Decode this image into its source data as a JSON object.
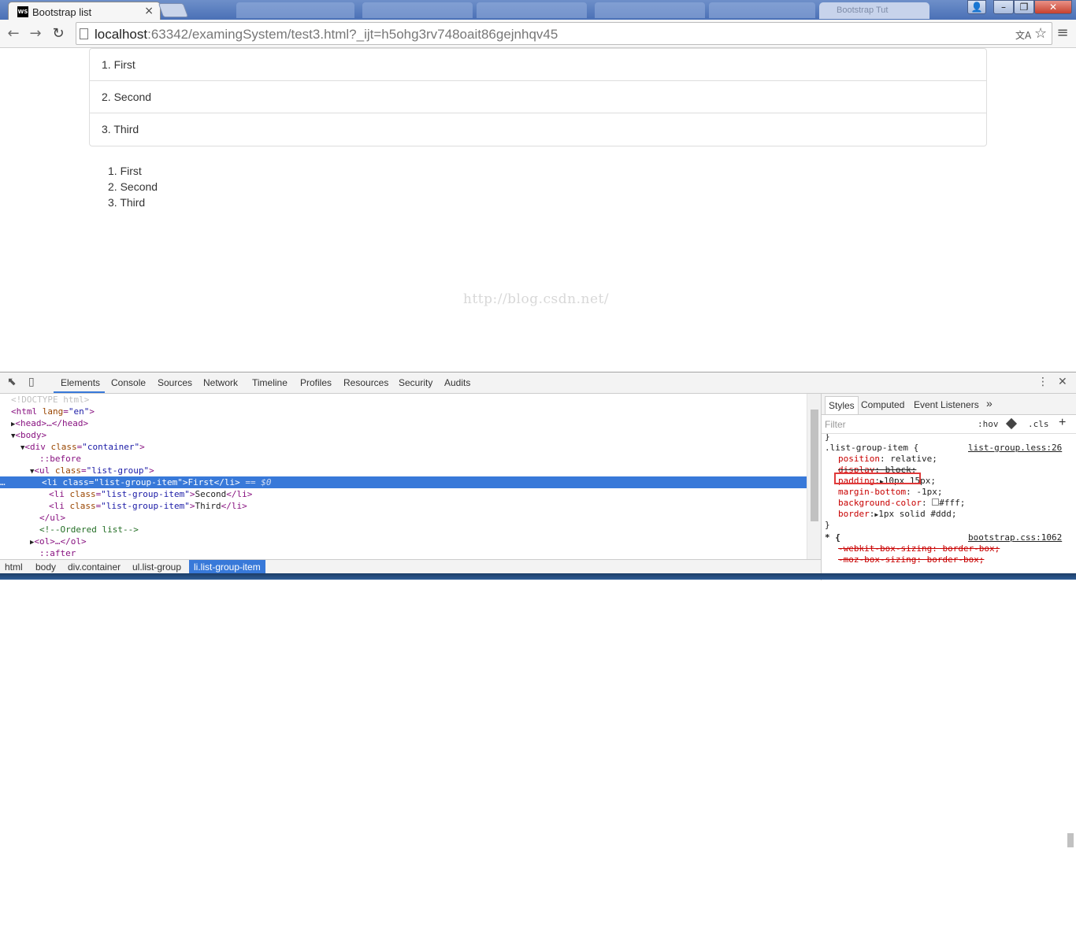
{
  "browser": {
    "tab": {
      "title": "Bootstrap list",
      "favicon": "WS",
      "close": "×"
    },
    "inactive_tab": {
      "title": "Bootstrap Tut"
    },
    "window_controls": {
      "user": "👤",
      "minimize": "–",
      "maximize": "❐",
      "close": "✕"
    },
    "toolbar": {
      "back": "←",
      "forward": "→",
      "reload": "↻",
      "url_host": "localhost",
      "url_rest": ":63342/examingSystem/test3.html?_ijt=h5ohg3rv748oait86gejnhqv45",
      "translate_icon": "文A",
      "star": "☆",
      "menu": "≡"
    }
  },
  "page": {
    "list_group": [
      "1. First",
      "2. Second",
      "3. Third"
    ],
    "ordered_list": [
      "1. First",
      "2. Second",
      "3. Third"
    ],
    "watermark": "http://blog.csdn.net/"
  },
  "devtools": {
    "tabs": [
      "Elements",
      "Console",
      "Sources",
      "Network",
      "Timeline",
      "Profiles",
      "Resources",
      "Security",
      "Audits"
    ],
    "active_tab": "Elements",
    "icons": {
      "inspect": "⬉",
      "device": "▯",
      "more": "⋮",
      "close": "✕"
    },
    "dom": {
      "doctype": "<!DOCTYPE html>",
      "html_open": "html",
      "html_attr": "lang",
      "html_val": "\"en\"",
      "head": "head",
      "head_ellipsis": "…</head>",
      "body": "body",
      "div": "div",
      "div_attr": "class",
      "div_val": "\"container\"",
      "before": "::before",
      "ul": "ul",
      "ul_attr": "class",
      "ul_val": "\"list-group\"",
      "li_attr": "class",
      "li_val": "\"list-group-item\"",
      "li1": "First",
      "li2": "Second",
      "li3": "Third",
      "selected_marker": "== $0",
      "ul_close": "</ul>",
      "comment": "<!--Ordered list-->",
      "ol": "<ol>…</ol>",
      "after": "::after",
      "dots": "…"
    },
    "breadcrumbs": [
      "html",
      "body",
      "div.container",
      "ul.list-group",
      "li.list-group-item"
    ],
    "side": {
      "tabs": [
        "Styles",
        "Computed",
        "Event Listeners",
        "»"
      ],
      "filter_placeholder": "Filter",
      "hov": ":hov",
      "cls": ".cls",
      "plus": "+",
      "rule1": {
        "selector": ".list-group-item {",
        "source": "list-group.less:26",
        "props": [
          {
            "name": "position",
            "value": "relative;"
          },
          {
            "name": "display",
            "value": "block;"
          },
          {
            "name": "padding",
            "value": "10px 15px;"
          },
          {
            "name": "margin-bottom",
            "value": "-1px;"
          },
          {
            "name": "background-color",
            "value": "#fff;"
          },
          {
            "name": "border",
            "value": "1px solid #ddd;"
          }
        ],
        "close": "}"
      },
      "rule2": {
        "selector": "* {",
        "source": "bootstrap.css:1062",
        "prop1": "-webkit-box-sizing: border-box;",
        "prop2": "-moz-box-sizing: border-box;"
      }
    }
  },
  "colors": {
    "accent": "#3879d9",
    "highlight_box": "#e03a3a"
  }
}
